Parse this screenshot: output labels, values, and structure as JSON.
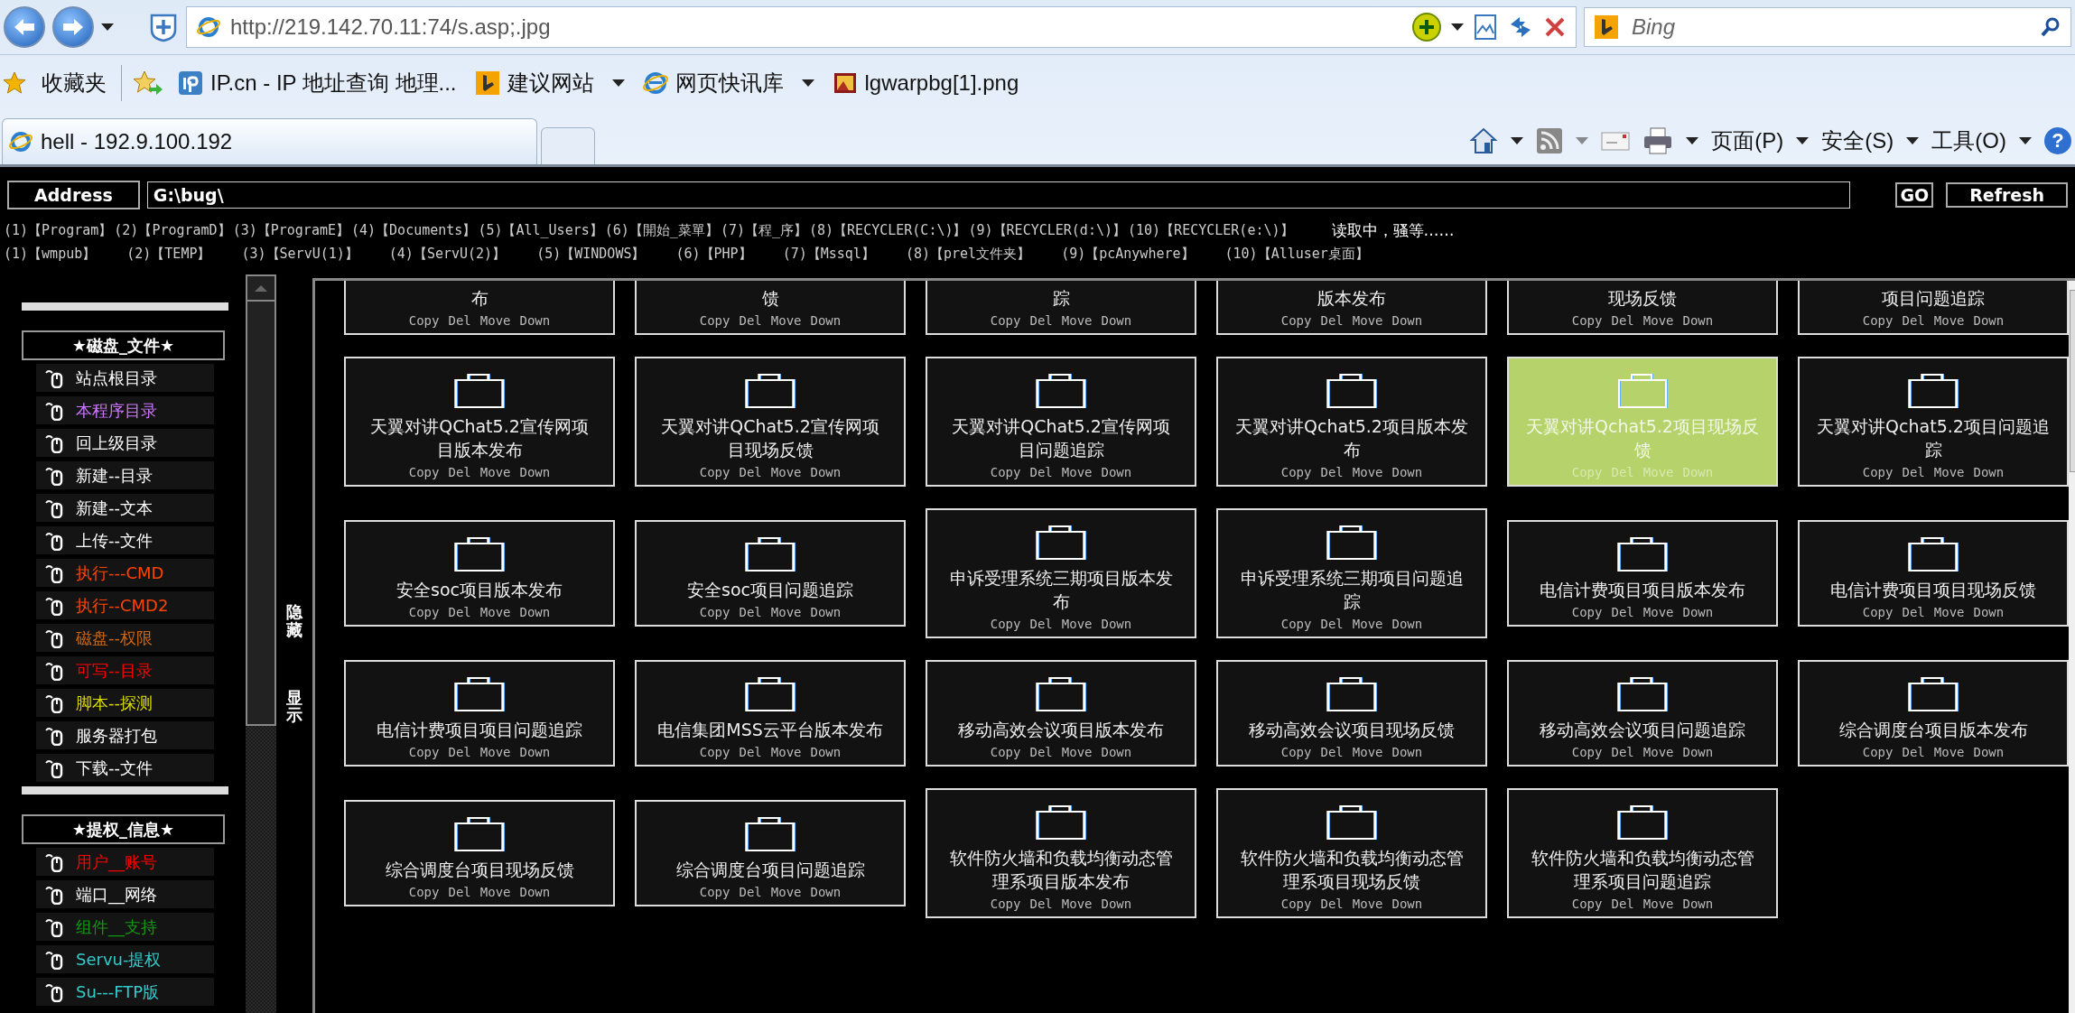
{
  "browser": {
    "url": "http://219.142.70.11:74/s.asp;.jpg",
    "search_placeholder": "Bing",
    "favorites_label": "收藏夹",
    "favorites": [
      {
        "label": "IP.cn - IP 地址查询  地理...",
        "kind": "ip",
        "dropdown": false
      },
      {
        "label": "建议网站",
        "kind": "search",
        "dropdown": true
      },
      {
        "label": "网页快讯库",
        "kind": "page",
        "dropdown": true
      },
      {
        "label": "lgwarpbg[1].png",
        "kind": "image",
        "dropdown": false
      }
    ],
    "tab_title": "hell - 192.9.100.192",
    "commands": [
      "页面(P)",
      "安全(S)",
      "工具(O)"
    ],
    "help": "?"
  },
  "address": {
    "label": "Address",
    "value": "G:\\bug\\",
    "go": "GO",
    "refresh": "Refresh"
  },
  "quick_link_rows": [
    {
      "links": [
        "(1)【Program】",
        "(2)【ProgramD】",
        "(3)【ProgramE】",
        "(4)【Documents】",
        "(5)【All_Users】",
        "(6)【開始_菜單】",
        "(7)【程_序】",
        "(8)【RECYCLER(C:\\)】",
        "(9)【RECYCLER(d:\\)】",
        "(10)【RECYCLER(e:\\)】"
      ],
      "status": "读取中，骚等……"
    },
    {
      "links": [
        "(1)【wmpub】",
        "(2)【TEMP】",
        "(3)【ServU(1)】",
        "(4)【ServU(2)】",
        "(5)【WINDOWS】",
        "(6)【PHP】",
        "(7)【Mssql】",
        "(8)【prel文件夹】",
        "(9)【pcAnywhere】",
        "(10)【Alluser桌面】"
      ]
    }
  ],
  "sidebar": {
    "sections": [
      {
        "title": "★磁盘_文件★",
        "items": [
          {
            "label": "站点根目录",
            "color": "#ffffff"
          },
          {
            "label": "本程序目录",
            "color": "#cc77ff"
          },
          {
            "label": "回上级目录",
            "color": "#ffffff"
          },
          {
            "label": "新建--目录",
            "color": "#ffffff"
          },
          {
            "label": "新建--文本",
            "color": "#ffffff"
          },
          {
            "label": "上传--文件",
            "color": "#ffffff"
          },
          {
            "label": "执行---CMD",
            "color": "#ff4400"
          },
          {
            "label": "执行--CMD2",
            "color": "#ff4400"
          },
          {
            "label": "磁盘--权限",
            "color": "#cc6611"
          },
          {
            "label": "可写--目录",
            "color": "#ff0000"
          },
          {
            "label": "脚本--探测",
            "color": "#dddd00"
          },
          {
            "label": "服务器打包",
            "color": "#ffffff"
          },
          {
            "label": "下载--文件",
            "color": "#ffffff"
          }
        ]
      },
      {
        "title": "★提权_信息★",
        "items": [
          {
            "label": "用户__账号",
            "color": "#ff0000"
          },
          {
            "label": "端口__网络",
            "color": "#ffffff"
          },
          {
            "label": "组件__支持",
            "color": "#119911"
          },
          {
            "label": "Servu-提权",
            "color": "#33cccc"
          },
          {
            "label": "Su---FTP版",
            "color": "#33cccc"
          }
        ]
      }
    ]
  },
  "toggle": {
    "hide": "隐藏",
    "show": "显示"
  },
  "folders": [
    {
      "name": "布",
      "cut": true,
      "selected": false,
      "actions": [
        "Copy",
        "Del",
        "Move",
        "Down"
      ]
    },
    {
      "name": "馈",
      "cut": true,
      "selected": false,
      "actions": [
        "Copy",
        "Del",
        "Move",
        "Down"
      ]
    },
    {
      "name": "踪",
      "cut": true,
      "selected": false,
      "actions": [
        "Copy",
        "Del",
        "Move",
        "Down"
      ]
    },
    {
      "name": "版本发布",
      "cut": true,
      "selected": false,
      "actions": [
        "Copy",
        "Del",
        "Move",
        "Down"
      ]
    },
    {
      "name": "现场反馈",
      "cut": true,
      "selected": false,
      "actions": [
        "Copy",
        "Del",
        "Move",
        "Down"
      ]
    },
    {
      "name": "项目问题追踪",
      "cut": true,
      "selected": false,
      "actions": [
        "Copy",
        "Del",
        "Move",
        "Down"
      ]
    },
    {
      "name": "天翼对讲QChat5.2宣传网项目版本发布",
      "cut": false,
      "selected": false,
      "actions": [
        "Copy",
        "Del",
        "Move",
        "Down"
      ]
    },
    {
      "name": "天翼对讲QChat5.2宣传网项目现场反馈",
      "cut": false,
      "selected": false,
      "actions": [
        "Copy",
        "Del",
        "Move",
        "Down"
      ]
    },
    {
      "name": "天翼对讲QChat5.2宣传网项目问题追踪",
      "cut": false,
      "selected": false,
      "actions": [
        "Copy",
        "Del",
        "Move",
        "Down"
      ]
    },
    {
      "name": "天翼对讲Qchat5.2项目版本发布",
      "cut": false,
      "selected": false,
      "actions": [
        "Copy",
        "Del",
        "Move",
        "Down"
      ]
    },
    {
      "name": "天翼对讲Qchat5.2项目现场反馈",
      "cut": false,
      "selected": true,
      "actions": [
        "Copy",
        "Del",
        "Move",
        "Down"
      ]
    },
    {
      "name": "天翼对讲Qchat5.2项目问题追踪",
      "cut": false,
      "selected": false,
      "actions": [
        "Copy",
        "Del",
        "Move",
        "Down"
      ]
    },
    {
      "name": "安全soc项目版本发布",
      "cut": false,
      "selected": false,
      "actions": [
        "Copy",
        "Del",
        "Move",
        "Down"
      ]
    },
    {
      "name": "安全soc项目问题追踪",
      "cut": false,
      "selected": false,
      "actions": [
        "Copy",
        "Del",
        "Move",
        "Down"
      ]
    },
    {
      "name": "申诉受理系统三期项目版本发布",
      "cut": false,
      "selected": false,
      "actions": [
        "Copy",
        "Del",
        "Move",
        "Down"
      ]
    },
    {
      "name": "申诉受理系统三期项目问题追踪",
      "cut": false,
      "selected": false,
      "actions": [
        "Copy",
        "Del",
        "Move",
        "Down"
      ]
    },
    {
      "name": "电信计费项目项目版本发布",
      "cut": false,
      "selected": false,
      "actions": [
        "Copy",
        "Del",
        "Move",
        "Down"
      ]
    },
    {
      "name": "电信计费项目项目现场反馈",
      "cut": false,
      "selected": false,
      "actions": [
        "Copy",
        "Del",
        "Move",
        "Down"
      ]
    },
    {
      "name": "电信计费项目项目问题追踪",
      "cut": false,
      "selected": false,
      "actions": [
        "Copy",
        "Del",
        "Move",
        "Down"
      ]
    },
    {
      "name": "电信集团MSS云平台版本发布",
      "cut": false,
      "selected": false,
      "actions": [
        "Copy",
        "Del",
        "Move",
        "Down"
      ]
    },
    {
      "name": "移动高效会议项目版本发布",
      "cut": false,
      "selected": false,
      "actions": [
        "Copy",
        "Del",
        "Move",
        "Down"
      ]
    },
    {
      "name": "移动高效会议项目现场反馈",
      "cut": false,
      "selected": false,
      "actions": [
        "Copy",
        "Del",
        "Move",
        "Down"
      ]
    },
    {
      "name": "移动高效会议项目问题追踪",
      "cut": false,
      "selected": false,
      "actions": [
        "Copy",
        "Del",
        "Move",
        "Down"
      ]
    },
    {
      "name": "综合调度台项目版本发布",
      "cut": false,
      "selected": false,
      "actions": [
        "Copy",
        "Del",
        "Move",
        "Down"
      ]
    },
    {
      "name": "综合调度台项目现场反馈",
      "cut": false,
      "selected": false,
      "actions": [
        "Copy",
        "Del",
        "Move",
        "Down"
      ]
    },
    {
      "name": "综合调度台项目问题追踪",
      "cut": false,
      "selected": false,
      "actions": [
        "Copy",
        "Del",
        "Move",
        "Down"
      ]
    },
    {
      "name": "软件防火墙和负载均衡动态管理系项目版本发布",
      "cut": false,
      "selected": false,
      "actions": [
        "Copy",
        "Del",
        "Move",
        "Down"
      ]
    },
    {
      "name": "软件防火墙和负载均衡动态管理系项目现场反馈",
      "cut": false,
      "selected": false,
      "actions": [
        "Copy",
        "Del",
        "Move",
        "Down"
      ]
    },
    {
      "name": "软件防火墙和负载均衡动态管理系项目问题追踪",
      "cut": false,
      "selected": false,
      "actions": [
        "Copy",
        "Del",
        "Move",
        "Down"
      ]
    }
  ]
}
